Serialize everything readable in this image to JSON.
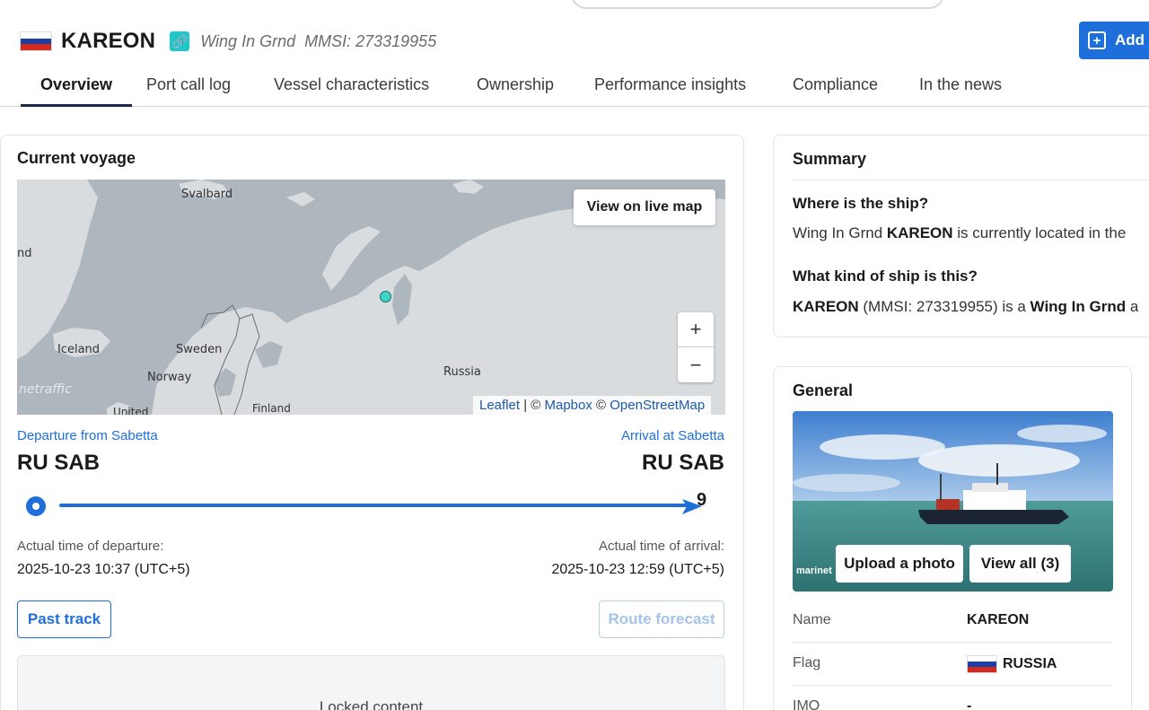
{
  "vessel": {
    "name": "KAREON",
    "type": "Wing In Grnd",
    "mmsi_label": "MMSI: 273319955"
  },
  "header": {
    "add_button_label": "Add"
  },
  "tabs": [
    {
      "label": "Overview",
      "active": true
    },
    {
      "label": "Port call log"
    },
    {
      "label": "Vessel characteristics"
    },
    {
      "label": "Ownership"
    },
    {
      "label": "Performance insights"
    },
    {
      "label": "Compliance"
    },
    {
      "label": "In the news"
    }
  ],
  "voyage": {
    "title": "Current voyage",
    "map": {
      "live_button": "View on live map",
      "zoom_in": "+",
      "zoom_out": "−",
      "labels": [
        "Svalbard",
        "nd",
        "Iceland",
        "Sweden",
        "Norway",
        "Russia",
        "Finland",
        "United"
      ],
      "watermark": "netraffic",
      "attribution": {
        "leaflet": "Leaflet",
        "sep": " | © ",
        "mapbox": "Mapbox",
        "osm_prefix": " © ",
        "osm": "OpenStreetMap"
      }
    },
    "departure_label": "Departure from Sabetta",
    "arrival_label": "Arrival at Sabetta",
    "departure_code": "RU SAB",
    "arrival_code": "RU SAB",
    "end_marker": "9",
    "atd_label": "Actual time of departure:",
    "ata_label": "Actual time of arrival:",
    "atd_value": "2025-10-23 10:37 (UTC+5)",
    "ata_value": "2025-10-23 12:59 (UTC+5)",
    "past_track": "Past track",
    "route_forecast": "Route forecast",
    "locked_text": "Locked content"
  },
  "summary": {
    "title": "Summary",
    "q1": "Where is the ship?",
    "a1_prefix": "Wing In Grnd ",
    "a1_name": "KAREON",
    "a1_suffix": " is currently located in the",
    "q2": "What kind of ship is this?",
    "a2_name": "KAREON",
    "a2_mid": " (MMSI: 273319955) is a ",
    "a2_type": "Wing In Grnd",
    "a2_suffix": " a"
  },
  "general": {
    "title": "General",
    "upload_photo": "Upload a photo",
    "view_all": "View all (3)",
    "photo_watermark": "marinet",
    "rows": [
      {
        "key": "Name",
        "value": "KAREON"
      },
      {
        "key": "Flag",
        "value": "RUSSIA"
      },
      {
        "key": "IMO",
        "value": "-"
      }
    ]
  },
  "colors": {
    "accent": "#1e6fd9",
    "map_land": "#d9dcde",
    "map_sea": "#aeb6be",
    "vessel_marker": "#3bd6c6",
    "tab_underline": "#1d2a47"
  }
}
